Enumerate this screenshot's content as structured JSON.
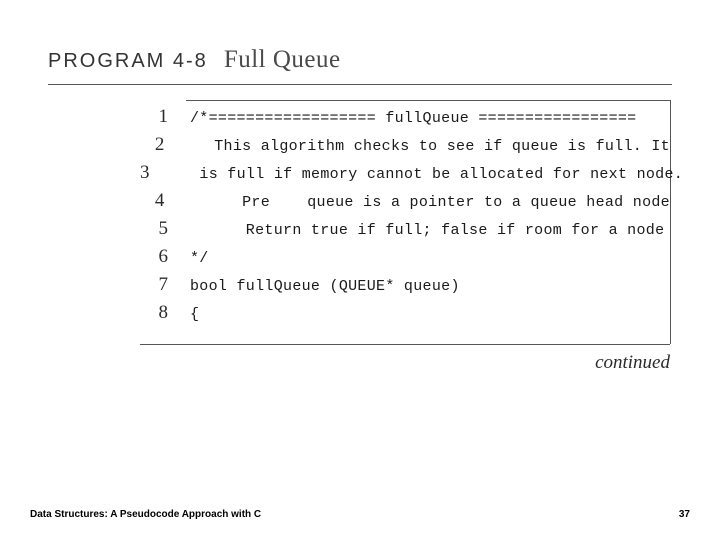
{
  "header": {
    "label": "PROGRAM 4-8",
    "title": "Full Queue"
  },
  "code": {
    "lines": [
      {
        "n": "1",
        "text": "/*================== fullQueue ================="
      },
      {
        "n": "2",
        "text": "   This algorithm checks to see if queue is full. It"
      },
      {
        "n": "3",
        "text": "   is full if memory cannot be allocated for next node."
      },
      {
        "n": "4",
        "text": "      Pre    queue is a pointer to a queue head node"
      },
      {
        "n": "5",
        "text": "      Return true if full; false if room for a node"
      },
      {
        "n": "6",
        "text": "*/"
      },
      {
        "n": "7",
        "text": "bool fullQueue (QUEUE* queue)"
      },
      {
        "n": "8",
        "text": "{"
      }
    ]
  },
  "continued": "continued",
  "footer": {
    "left": "Data Structures: A Pseudocode Approach with C",
    "right": "37"
  }
}
